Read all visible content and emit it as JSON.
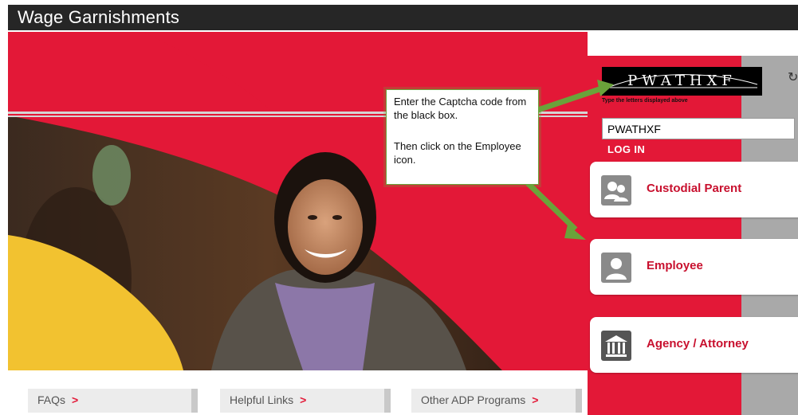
{
  "header": {
    "title": "Wage Garnishments"
  },
  "captcha": {
    "image_text": "PWATHXF",
    "help_text": "Type the letters displayed above",
    "input_value": "PWATHXF",
    "login_label": "LOG IN"
  },
  "roles": [
    {
      "label": "Custodial Parent",
      "icon": "users-icon"
    },
    {
      "label": "Employee",
      "icon": "user-icon"
    },
    {
      "label": "Agency / Attorney",
      "icon": "building-icon"
    }
  ],
  "footer_tabs": [
    {
      "label": "FAQs",
      "arrow": ">"
    },
    {
      "label": "Helpful Links",
      "arrow": ">"
    },
    {
      "label": "Other ADP Programs",
      "arrow": ">"
    }
  ],
  "callout": {
    "line1": "Enter the Captcha code from the black box.",
    "line2": "Then click on the Employee icon."
  },
  "colors": {
    "brand_red": "#e31837",
    "header_dark": "#262626",
    "callout_green": "#6aa33a"
  }
}
